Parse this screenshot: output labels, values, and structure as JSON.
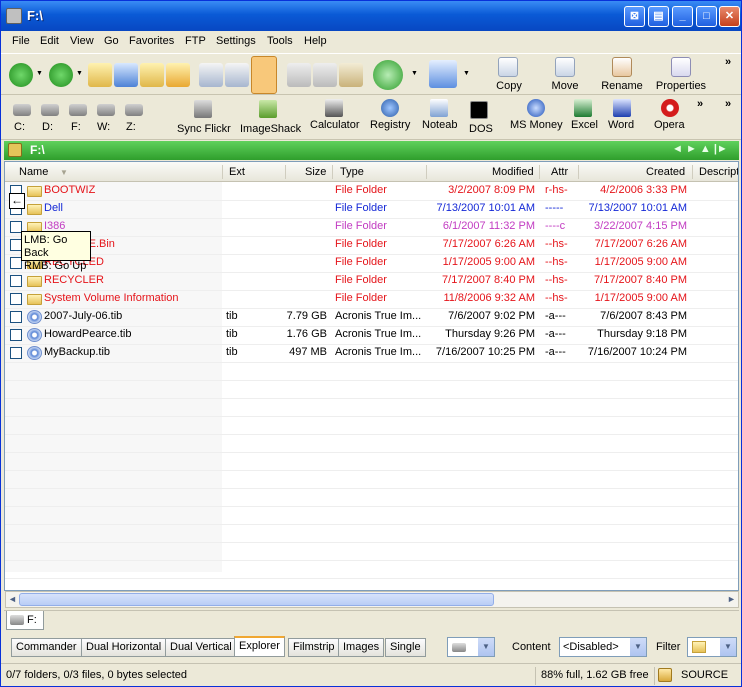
{
  "window": {
    "title": "F:\\"
  },
  "menu": [
    "File",
    "Edit",
    "View",
    "Go",
    "Favorites",
    "FTP",
    "Settings",
    "Tools",
    "Help"
  ],
  "toolbar": {
    "copy": "Copy",
    "move": "Move",
    "rename": "Rename",
    "properties": "Properties",
    "more": "»"
  },
  "drives": [
    "C:",
    "D:",
    "F:",
    "W:",
    "Z:"
  ],
  "apps": [
    "Sync Flickr",
    "ImageShack",
    "Calculator",
    "Registry",
    "Noteab",
    "DOS",
    "MS Money",
    "Excel",
    "Word",
    "Opera"
  ],
  "path": {
    "text": "F:\\",
    "nav": "◄ ► ▲ |►"
  },
  "columns": {
    "name": "Name",
    "ext": "Ext",
    "size": "Size",
    "type": "Type",
    "modified": "Modified",
    "attr": "Attr",
    "created": "Created",
    "desc": "Descript"
  },
  "rows": [
    {
      "name": "BOOTWIZ",
      "ext": "",
      "size": "",
      "type": "File Folder",
      "modified": "3/2/2007 8:09 PM",
      "attr": "r-hs-",
      "created": "4/2/2006 3:33 PM",
      "color": "#e5141a",
      "icon": "folder"
    },
    {
      "name": "Dell",
      "ext": "",
      "size": "",
      "type": "File Folder",
      "modified": "7/13/2007 10:01 AM",
      "attr": "-----",
      "created": "7/13/2007 10:01 AM",
      "color": "#1428d6",
      "icon": "folder"
    },
    {
      "name": "I386",
      "ext": "",
      "size": "",
      "type": "File Folder",
      "modified": "6/1/2007 11:32 PM",
      "attr": "----c",
      "created": "3/22/2007 4:15 PM",
      "color": "#c23cc2",
      "icon": "folder"
    },
    {
      "name": "RECYCLE.Bin",
      "ext": "",
      "size": "",
      "type": "File Folder",
      "modified": "7/17/2007 6:26 AM",
      "attr": "--hs-",
      "created": "7/17/2007 6:26 AM",
      "color": "#e5141a",
      "icon": "folder"
    },
    {
      "name": "RECYCLED",
      "ext": "",
      "size": "",
      "type": "File Folder",
      "modified": "1/17/2005 9:00 AM",
      "attr": "--hs-",
      "created": "1/17/2005 9:00 AM",
      "color": "#e5141a",
      "icon": "folder"
    },
    {
      "name": "RECYCLER",
      "ext": "",
      "size": "",
      "type": "File Folder",
      "modified": "7/17/2007 8:40 PM",
      "attr": "--hs-",
      "created": "7/17/2007 8:40 PM",
      "color": "#e5141a",
      "icon": "folder"
    },
    {
      "name": "System Volume Information",
      "ext": "",
      "size": "",
      "type": "File Folder",
      "modified": "11/8/2006 9:32 AM",
      "attr": "--hs-",
      "created": "1/17/2005 9:00 AM",
      "color": "#e5141a",
      "icon": "folder"
    },
    {
      "name": "2007-July-06.tib",
      "ext": "tib",
      "size": "7.79 GB",
      "type": "Acronis True Im...",
      "modified": "7/6/2007 9:02 PM",
      "attr": "-a---",
      "created": "7/6/2007 8:43 PM",
      "color": "#000000",
      "icon": "tib"
    },
    {
      "name": "HowardPearce.tib",
      "ext": "tib",
      "size": "1.76 GB",
      "type": "Acronis True Im...",
      "modified": "Thursday 9:26 PM",
      "attr": "-a---",
      "created": "Thursday 9:18 PM",
      "color": "#000000",
      "icon": "tib"
    },
    {
      "name": "MyBackup.tib",
      "ext": "tib",
      "size": "497 MB",
      "type": "Acronis True Im...",
      "modified": "7/16/2007 10:25 PM",
      "attr": "-a---",
      "created": "7/16/2007 10:24 PM",
      "color": "#000000",
      "icon": "tib"
    }
  ],
  "tooltip": {
    "line1": "LMB: Go Back",
    "line2": "RMB: Go Up"
  },
  "drive_tab": "F:",
  "views": [
    "Commander",
    "Dual Horizontal",
    "Dual Vertical",
    "Explorer",
    "Filmstrip",
    "Images",
    "Single"
  ],
  "active_view": "Explorer",
  "content": {
    "label": "Content",
    "value": "<Disabled>"
  },
  "filter": {
    "label": "Filter"
  },
  "status": {
    "left": "0/7 folders, 0/3 files, 0 bytes selected",
    "free": "88% full, 1.62 GB free",
    "source": "SOURCE"
  }
}
